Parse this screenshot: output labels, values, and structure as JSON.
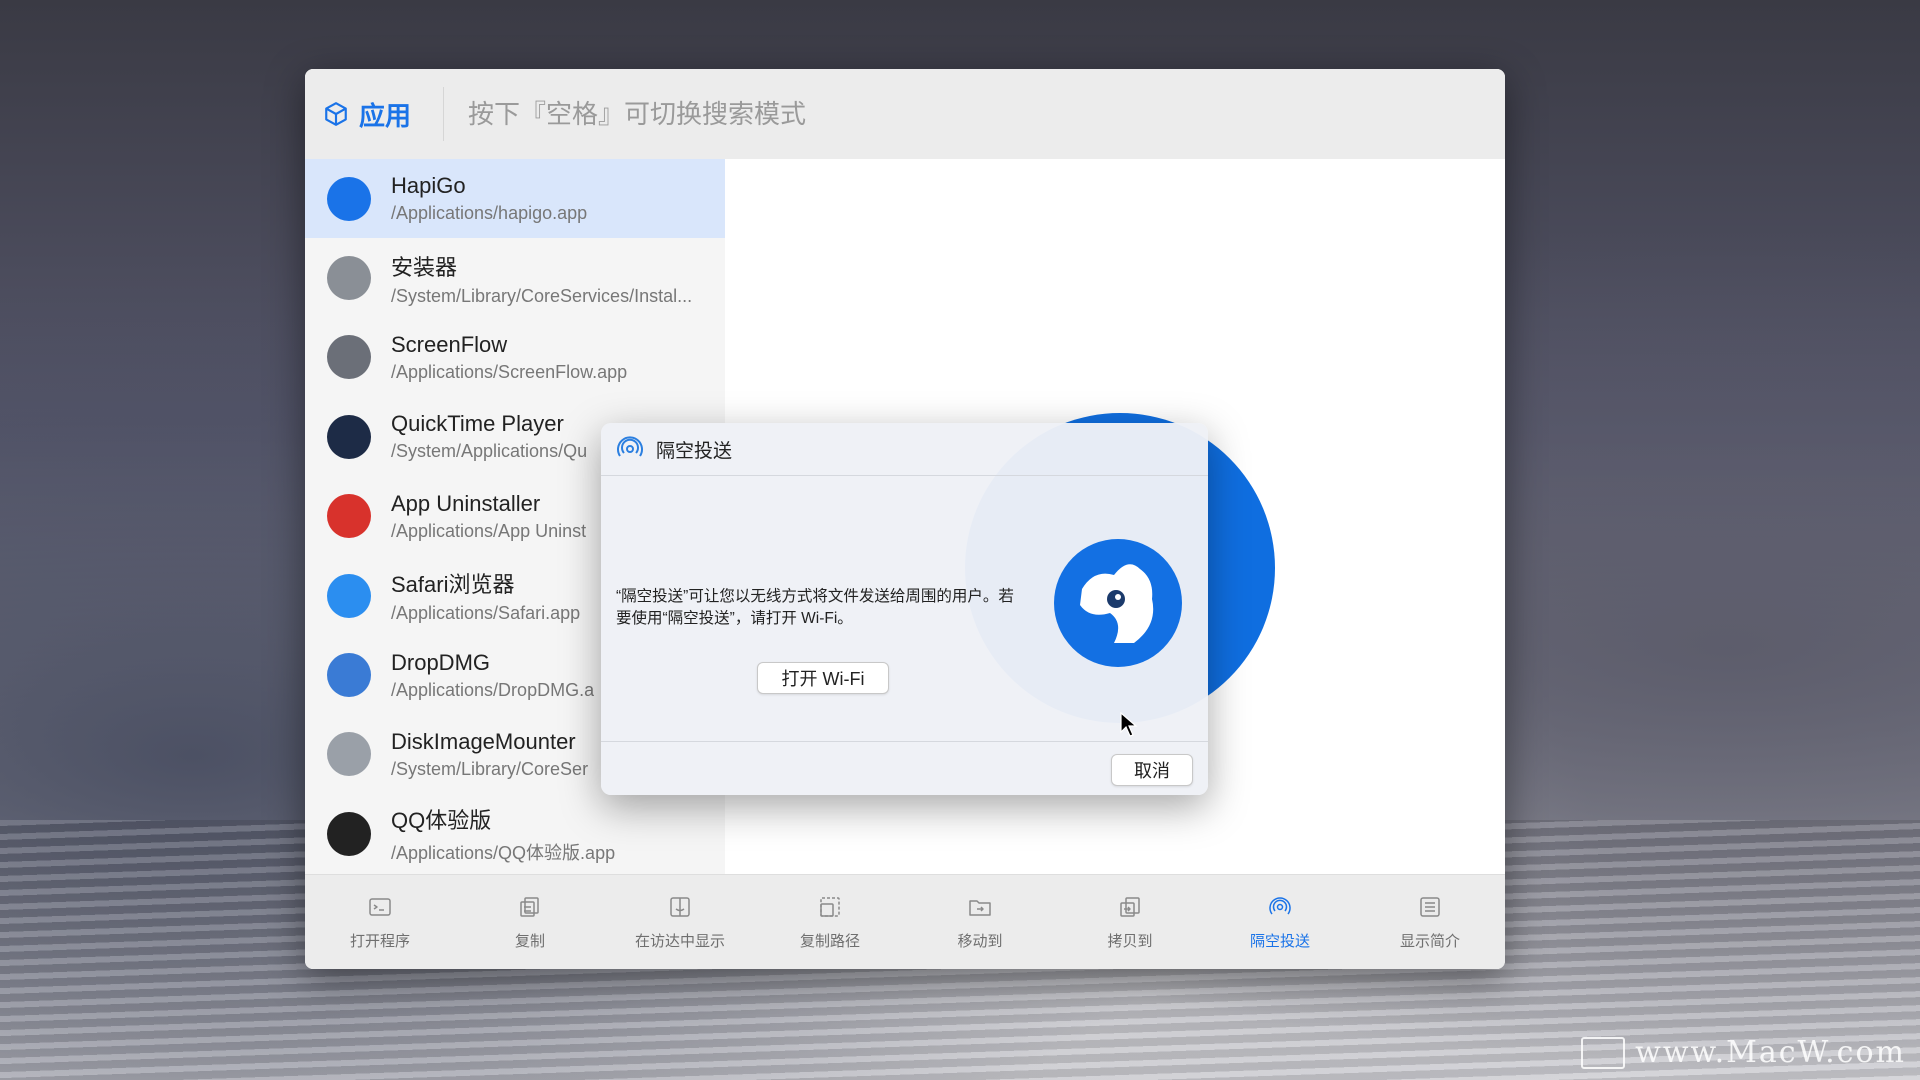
{
  "search": {
    "scope_label": "应用",
    "placeholder": "按下『空格』可切换搜索模式"
  },
  "results": [
    {
      "name": "HapiGo",
      "path": "/Applications/hapigo.app",
      "icon": "hapigo-icon",
      "color": "#1a73e8",
      "selected": true
    },
    {
      "name": "安装器",
      "path": "/System/Library/CoreServices/Instal...",
      "icon": "installer-icon",
      "color": "#8a8f96"
    },
    {
      "name": "ScreenFlow",
      "path": "/Applications/ScreenFlow.app",
      "icon": "screenflow-icon",
      "color": "#6b6f78"
    },
    {
      "name": "QuickTime Player",
      "path": "/System/Applications/Qu",
      "icon": "quicktime-icon",
      "color": "#1d2b46"
    },
    {
      "name": "App Uninstaller",
      "path": "/Applications/App Uninst",
      "icon": "magnet-icon",
      "color": "#d8322c"
    },
    {
      "name": "Safari浏览器",
      "path": "/Applications/Safari.app",
      "icon": "safari-icon",
      "color": "#2b8ef0"
    },
    {
      "name": "DropDMG",
      "path": "/Applications/DropDMG.a",
      "icon": "dropdmg-icon",
      "color": "#3a7bd5"
    },
    {
      "name": "DiskImageMounter",
      "path": "/System/Library/CoreSer",
      "icon": "disk-image-icon",
      "color": "#9aa0a8"
    },
    {
      "name": "QQ体验版",
      "path": "/Applications/QQ体验版.app",
      "icon": "qq-penguin-icon",
      "color": "#222222"
    }
  ],
  "toolbar": [
    {
      "label": "打开程序",
      "icon": "terminal-icon"
    },
    {
      "label": "复制",
      "icon": "copy-icon"
    },
    {
      "label": "在访达中显示",
      "icon": "finder-icon"
    },
    {
      "label": "复制路径",
      "icon": "copy-path-icon"
    },
    {
      "label": "移动到",
      "icon": "move-folder-icon"
    },
    {
      "label": "拷贝到",
      "icon": "copy-to-icon"
    },
    {
      "label": "隔空投送",
      "icon": "airdrop-icon",
      "active": true
    },
    {
      "label": "显示简介",
      "icon": "info-list-icon"
    }
  ],
  "dialog": {
    "title": "隔空投送",
    "message": "“隔空投送”可让您以无线方式将文件发送给周围的用户。若要使用“隔空投送”，请打开 Wi-Fi。",
    "primary_button": "打开 Wi-Fi",
    "cancel_button": "取消"
  },
  "watermark": "www.MacW.com",
  "colors": {
    "accent": "#1a73e8",
    "selected_row": "#d9e6fb"
  }
}
